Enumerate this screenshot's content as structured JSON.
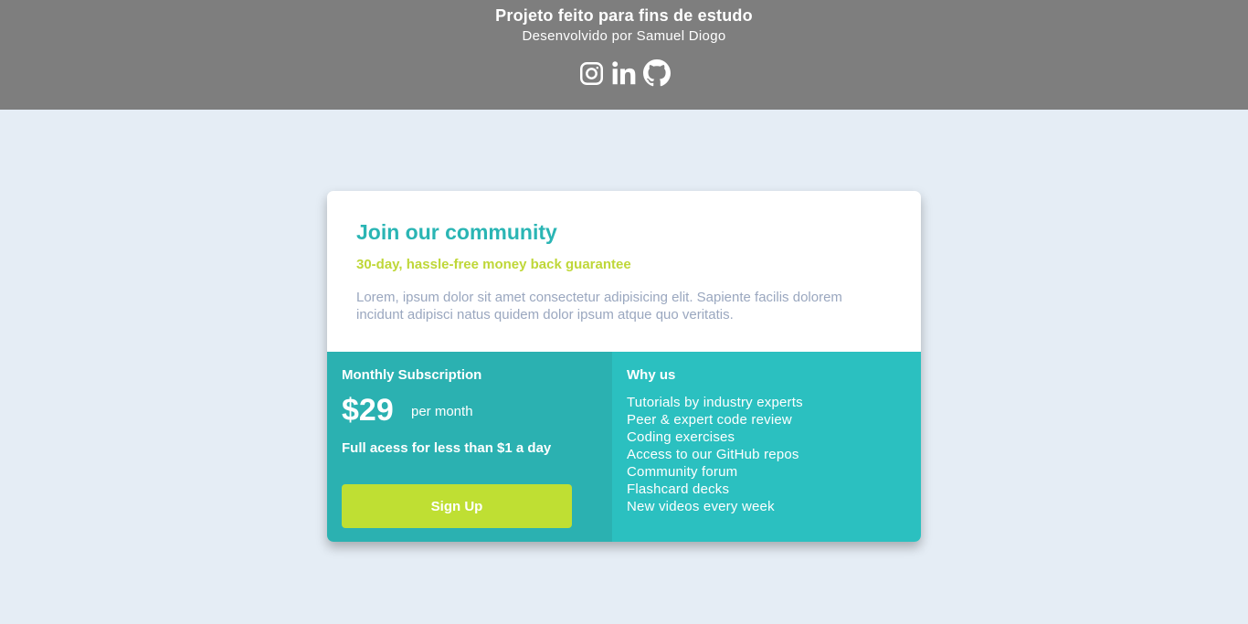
{
  "header": {
    "title": "Projeto feito para fins de estudo",
    "subtitle": "Desenvolvido por Samuel Diogo",
    "social": [
      {
        "icon": "instagram-icon"
      },
      {
        "icon": "linkedin-icon"
      },
      {
        "icon": "github-icon"
      }
    ]
  },
  "card": {
    "title": "Join our community",
    "guarantee": "30-day, hassle-free money back guarantee",
    "description": "Lorem, ipsum dolor sit amet consectetur adipisicing elit. Sapiente facilis dolorem incidunt adipisci natus quidem dolor ipsum atque quo veritatis."
  },
  "subscription": {
    "title": "Monthly Subscription",
    "price": "$29",
    "period": "per month",
    "access": "Full acess for less than $1 a day",
    "button": "Sign Up"
  },
  "why": {
    "title": "Why us",
    "items": [
      "Tutorials by industry experts",
      "Peer & expert code review",
      "Coding exercises",
      "Access to our GitHub repos",
      "Community forum",
      "Flashcard decks",
      "New videos every week"
    ]
  },
  "colors": {
    "header_bg": "#7e7e7e",
    "page_bg": "#e5edf5",
    "accent_teal": "#2ab5b4",
    "accent_lime": "#bfdf33",
    "left_panel": "#2bb1b1",
    "right_panel": "#2bc0c0",
    "muted_text": "#9aa7bf"
  }
}
